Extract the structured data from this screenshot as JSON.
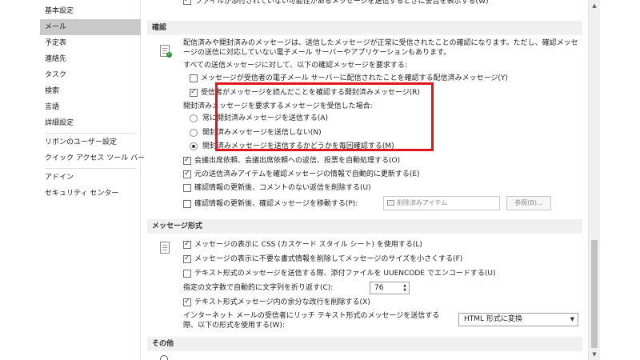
{
  "sidebar": {
    "items": [
      {
        "label": "基本設定"
      },
      {
        "label": "メール"
      },
      {
        "label": "予定表"
      },
      {
        "label": "連絡先"
      },
      {
        "label": "タスク"
      },
      {
        "label": "検索"
      },
      {
        "label": "言語"
      },
      {
        "label": "詳細設定"
      },
      {
        "label": "リボンのユーザー設定"
      },
      {
        "label": "クイック アクセス ツール バー"
      },
      {
        "label": "アドイン"
      },
      {
        "label": "セキュリティ センター"
      }
    ],
    "selected": "メール"
  },
  "top_partial": {
    "label": "ファイルが添付されていない可能性があるメッセージを送信するときに警告を表示する(W)"
  },
  "tracking": {
    "header": "確認",
    "description": "配信済みや開封済みのメッセージは、送信したメッセージが正常に受信されたことの確認になります。ただし、確認メッセージの送信に対応していない電子メール サーバーやアプリケーションもあります。",
    "all_sent_label": "すべての送信メッセージに対して、以下の確認メッセージを要求する:",
    "delivery_receipt": "メッセージが受信者の電子メール サーバーに配信されたことを確認する配信済みメッセージ(Y)",
    "read_receipt": "受信者がメッセージを読んだことを確認する開封済みメッセージ(R)",
    "on_request_label": "開封済みメッセージを要求するメッセージを受信した場合:",
    "radio_always": "常に開封済みメッセージを送信する(A)",
    "radio_never": "開封済みメッセージを送信しない(N)",
    "radio_ask": "開封済みメッセージを送信するかどうかを毎回確認する(M)",
    "auto_process": "会議出席依頼、会議出席依頼への返信、投票を自動処理する(O)",
    "update_original": "元の送信済みアイテムを確認メッセージの情報で自動的に更新する(E)",
    "delete_blank": "確認情報の更新後、コメントのない返信を削除する(U)",
    "move_receipts": "確認情報の更新後、確認メッセージを移動する(P):",
    "folder_placeholder": "削除済みアイテム",
    "browse_button": "参照(B)..."
  },
  "format": {
    "header": "メッセージ形式",
    "use_css": "メッセージの表示に CSS (カスケード スタイル シート) を使用する(L)",
    "remove_formatting": "メッセージの表示に不要な書式情報を削除してメッセージのサイズを小さくする(F)",
    "uuencode": "テキスト形式のメッセージを送信する際、添付ファイルを UUENCODE でエンコードする(U)",
    "wrap_label": "指定の文字数で自動的に文字列を折り返す(C):",
    "wrap_value": "76",
    "remove_line_breaks": "テキスト形式メッセージ内の余分な改行を削除する(X)",
    "internet_format_label": "インターネット メールの受信者にリッチ テキスト形式のメッセージを送信する際、以下の形式を使用する(W):",
    "internet_format_value": "HTML 形式に変換"
  },
  "other": {
    "header": "その他"
  },
  "colors": {
    "highlight": "#e2151d",
    "selected_nav": "#c9c9c9",
    "section_header_bg": "#f0f0f0"
  }
}
